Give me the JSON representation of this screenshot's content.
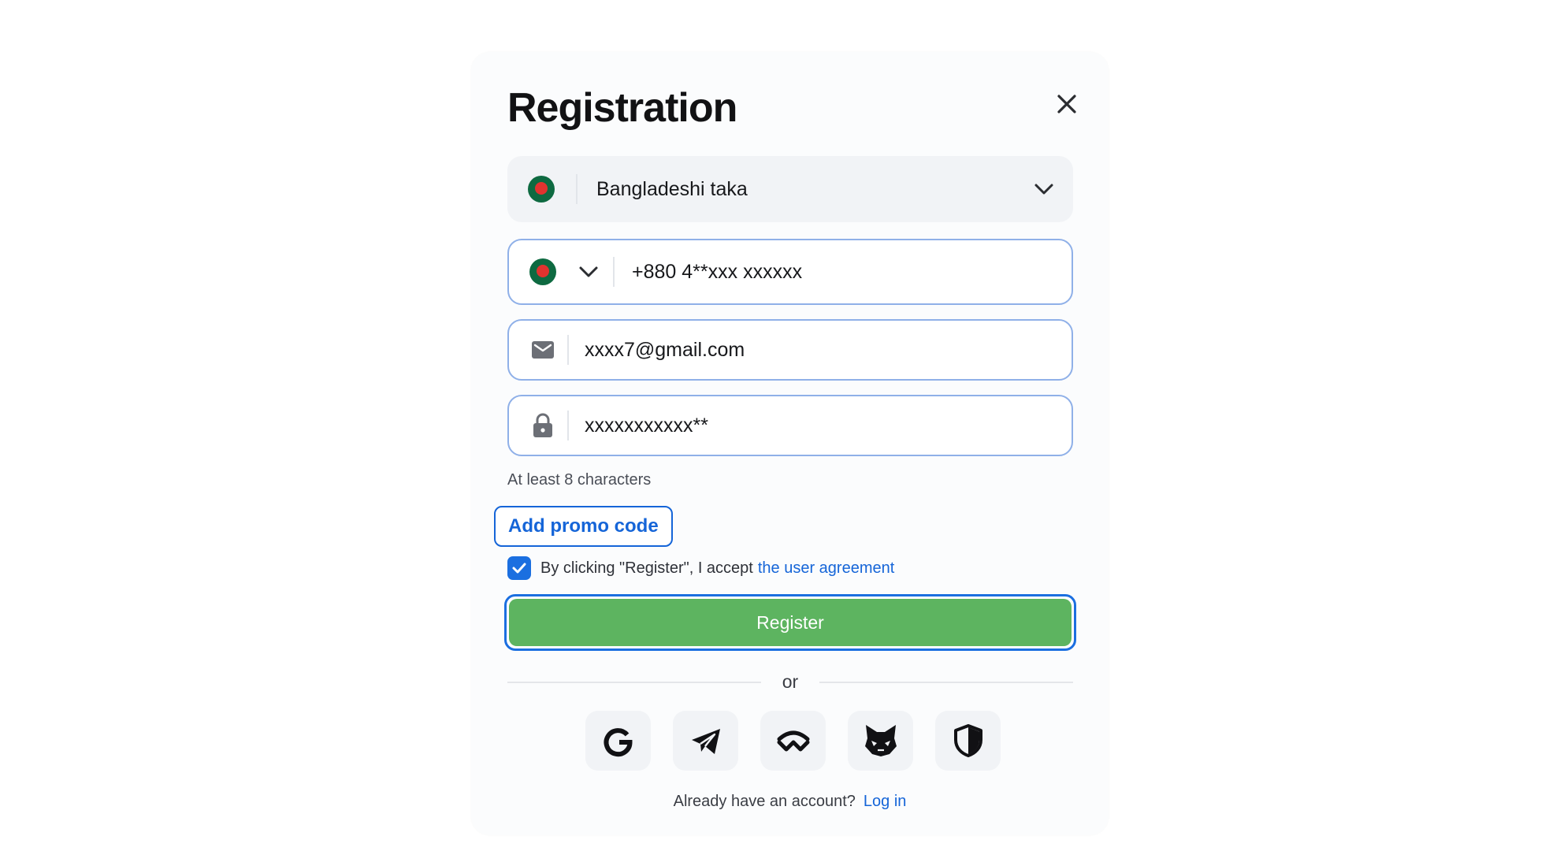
{
  "modal": {
    "title": "Registration",
    "close_icon": "close-icon"
  },
  "currency": {
    "flag": "bangladesh-flag-icon",
    "value": "Bangladeshi taka",
    "dropdown_icon": "chevron-down-icon"
  },
  "phone": {
    "flag": "bangladesh-flag-icon",
    "dropdown_icon": "chevron-down-icon",
    "value": "+880 4**xxx xxxxxx"
  },
  "email": {
    "icon": "envelope-icon",
    "value": "xxxx7@gmail.com"
  },
  "password": {
    "icon": "lock-icon",
    "value": "xxxxxxxxxxx**",
    "hint": "At least 8 characters"
  },
  "promo": {
    "label": "Add promo code"
  },
  "agreement": {
    "checked": true,
    "text": "By clicking \"Register\", I accept",
    "link": "the user agreement"
  },
  "register": {
    "label": "Register"
  },
  "divider": {
    "text": "or"
  },
  "socials": [
    "google-icon",
    "telegram-icon",
    "walletconnect-icon",
    "metamask-icon",
    "shield-icon"
  ],
  "footer": {
    "text": "Already have an account?",
    "link": "Log in"
  },
  "colors": {
    "accent": "#1565d8",
    "register_green": "#5db460",
    "input_border": "#8fb0e8"
  }
}
